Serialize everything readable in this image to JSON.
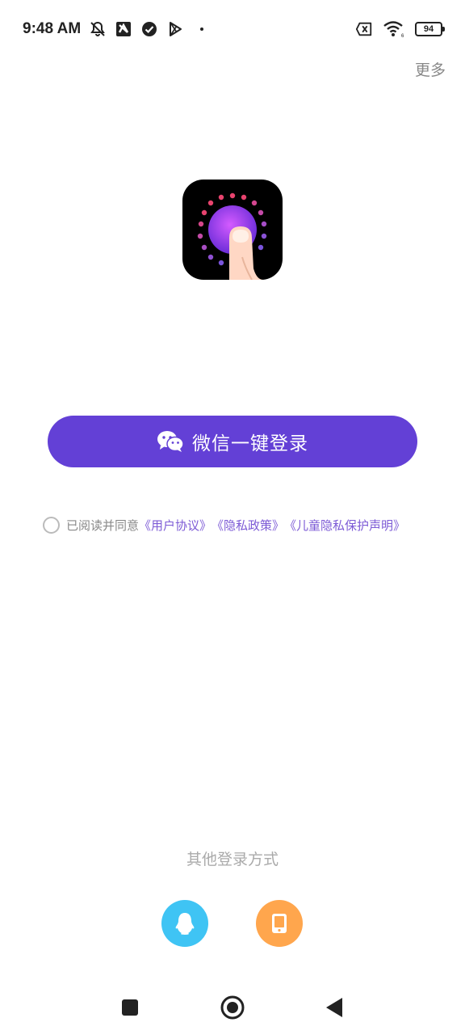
{
  "status_bar": {
    "time": "9:48 AM",
    "battery": "94",
    "icons": [
      "bell-muted-icon",
      "app-notification-icon",
      "check-circle-icon",
      "play-store-icon",
      "wifi-icon",
      "sim-error-icon"
    ]
  },
  "header": {
    "more_label": "更多"
  },
  "login": {
    "wechat_button_label": "微信一键登录"
  },
  "agreement": {
    "prefix": "已阅读并同意",
    "links": [
      "《用户协议》",
      "《隐私政策》",
      "《儿童隐私保护声明》"
    ]
  },
  "other_login": {
    "title": "其他登录方式",
    "options": [
      "qq-icon",
      "phone-icon"
    ]
  },
  "colors": {
    "primary": "#6340d6",
    "link": "#7d5bd6",
    "qq": "#3fc4f4",
    "phone": "#ffa64d"
  }
}
